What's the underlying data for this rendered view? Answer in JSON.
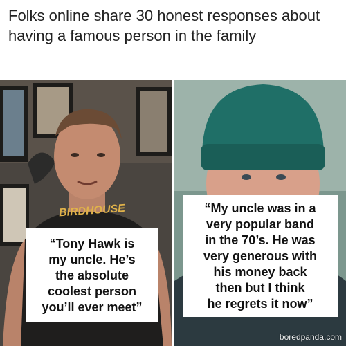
{
  "headline": "Folks online share 30 honest responses about having a famous person in the family",
  "left_panel": {
    "shirt_logo_text": "BIRDHOUSE",
    "caption": "“Tony Hawk is\nmy uncle. He’s\nthe absolute\ncoolest person\nyou’ll ever meet”"
  },
  "right_panel": {
    "caption": "“My uncle was in a\nvery popular band\nin the 70’s. He was\nvery generous with\nhis money back\nthen but I think\nhe regrets it now”",
    "watermark": "boredpanda.com"
  },
  "colors": {
    "headline_text": "#222222",
    "caption_bg": "#ffffff",
    "caption_text": "#111111",
    "beanie": "#1f6f67"
  }
}
